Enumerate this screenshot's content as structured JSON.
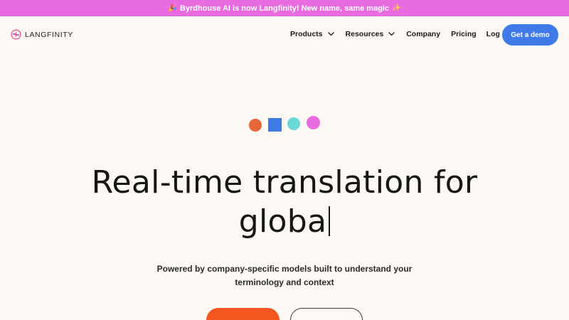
{
  "banner": {
    "emoji_left": "🎉",
    "text": "Byrdhouse AI is now Langfinity! New name, same magic",
    "emoji_right": "✨"
  },
  "nav": {
    "logo_text": "LANGFINITY",
    "items": [
      {
        "label": "Products",
        "has_dropdown": true
      },
      {
        "label": "Resources",
        "has_dropdown": true
      },
      {
        "label": "Company",
        "has_dropdown": false
      },
      {
        "label": "Pricing",
        "has_dropdown": false
      },
      {
        "label": "Log in",
        "has_dropdown": false
      }
    ],
    "cta_label": "Get a demo"
  },
  "hero": {
    "title_line1": "Real-time translation for",
    "title_line2": "globa",
    "subtitle_line1": "Powered by company-specific models built to understand your",
    "subtitle_line2": "terminology and context"
  },
  "colors": {
    "banner": "#e86be0",
    "accent_blue": "#3f7ae8",
    "accent_orange": "#f4571f",
    "shape_orange": "#e8663a",
    "shape_blue": "#3d7ae6",
    "shape_cyan": "#6bd8d8",
    "shape_pink": "#e86be0",
    "background": "#fcf9f5"
  }
}
